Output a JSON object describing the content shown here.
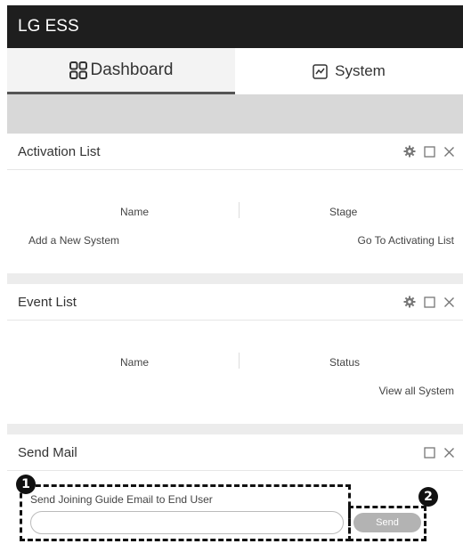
{
  "app": {
    "title": "LG ESS"
  },
  "tabs": [
    {
      "label": "Dashboard",
      "icon": "grid-icon",
      "active": true
    },
    {
      "label": "System",
      "icon": "chart-line-icon",
      "active": false
    }
  ],
  "activation_list": {
    "title": "Activation List",
    "columns": [
      "Name",
      "Stage"
    ],
    "add_link": "Add a New System",
    "goto_link": "Go To Activating List"
  },
  "event_list": {
    "title": "Event List",
    "columns": [
      "Name",
      "Status"
    ],
    "view_link": "View all System"
  },
  "send_mail": {
    "title": "Send Mail",
    "label": "Send Joining Guide Email to End User",
    "input_value": "",
    "input_placeholder": "",
    "send_label": "Send"
  },
  "annotations": {
    "marker1": "1",
    "marker2": "2"
  },
  "colors": {
    "titlebar": "#1e1e1e",
    "send_button": "#b3b3b3",
    "background": "#ececec"
  }
}
